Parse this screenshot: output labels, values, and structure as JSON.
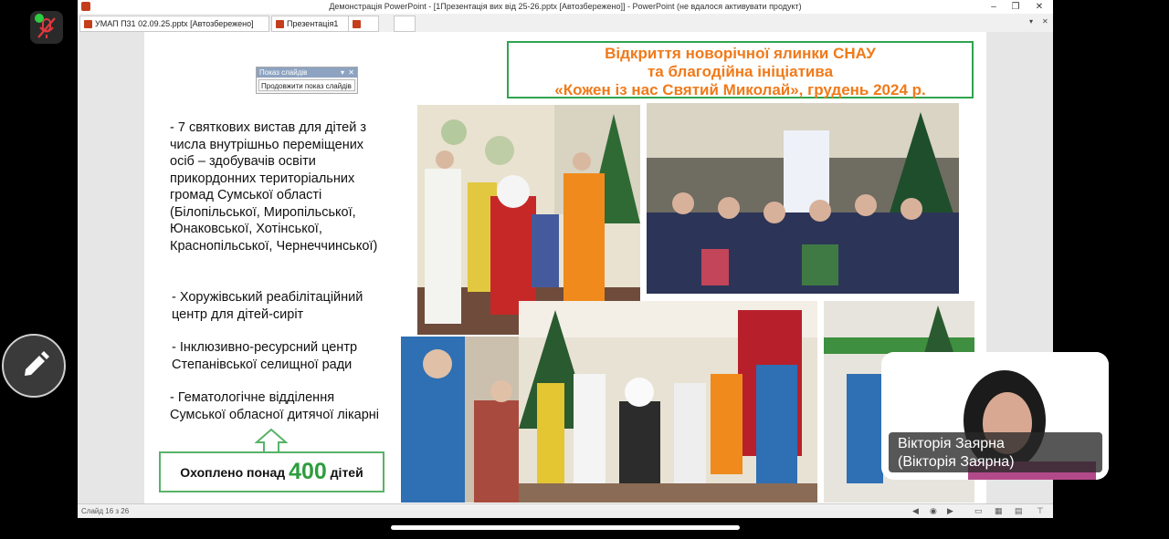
{
  "window": {
    "title": "Демонстрація PowerPoint - [1Презентація вих від 25-26.pptx [Автозбережено]] - PowerPoint (не вдалося активувати продукт)",
    "min_icon": "minimize-icon",
    "restore_icon": "restore-icon",
    "close_icon": "close-icon"
  },
  "tabs": [
    {
      "label": "УМАП П31 02.09.25.pptx [Автозбережено]"
    },
    {
      "label": "Презентація1"
    },
    {
      "label": ""
    },
    {
      "label": ""
    }
  ],
  "slideshow_popup": {
    "title": "Показ слайдів",
    "button": "Продовжити показ слайдів"
  },
  "slide": {
    "headline": [
      "Відкриття новорічної ялинки  СНАУ",
      "та благодійна ініціатива",
      "«Кожен із нас Святий Миколай», грудень 2024 р."
    ],
    "bullet_main": "- 7  святкових вистав для дітей з числа внутрішньо переміщених осіб – здобувачів освіти прикордонних територіальних громад Сумської області (Білопільської, Миропільської, Юнаковської, Хотінської, Краснопільської, Чернеччинської)",
    "bullet_2": "-  Хоружівський реабілітаційний центр для дітей-сиріт",
    "bullet_3": "-  Інклюзивно-ресурсний центр Степанівської селищної ради",
    "bullet_4": "- Гематологічне відділення Сумської обласної дитячої лікарні",
    "summary_prefix": "Охоплено понад",
    "summary_number": "400",
    "summary_suffix": "дітей"
  },
  "status": {
    "slide_counter": "Слайд 16 з 26"
  },
  "participant": {
    "name_line1": "Вікторія Заярна",
    "name_line2": "(Вікторія Заярна)"
  },
  "colors": {
    "headline_orange": "#f07a1a",
    "box_green": "#2ea44f",
    "number_green": "#2e9d3e"
  }
}
